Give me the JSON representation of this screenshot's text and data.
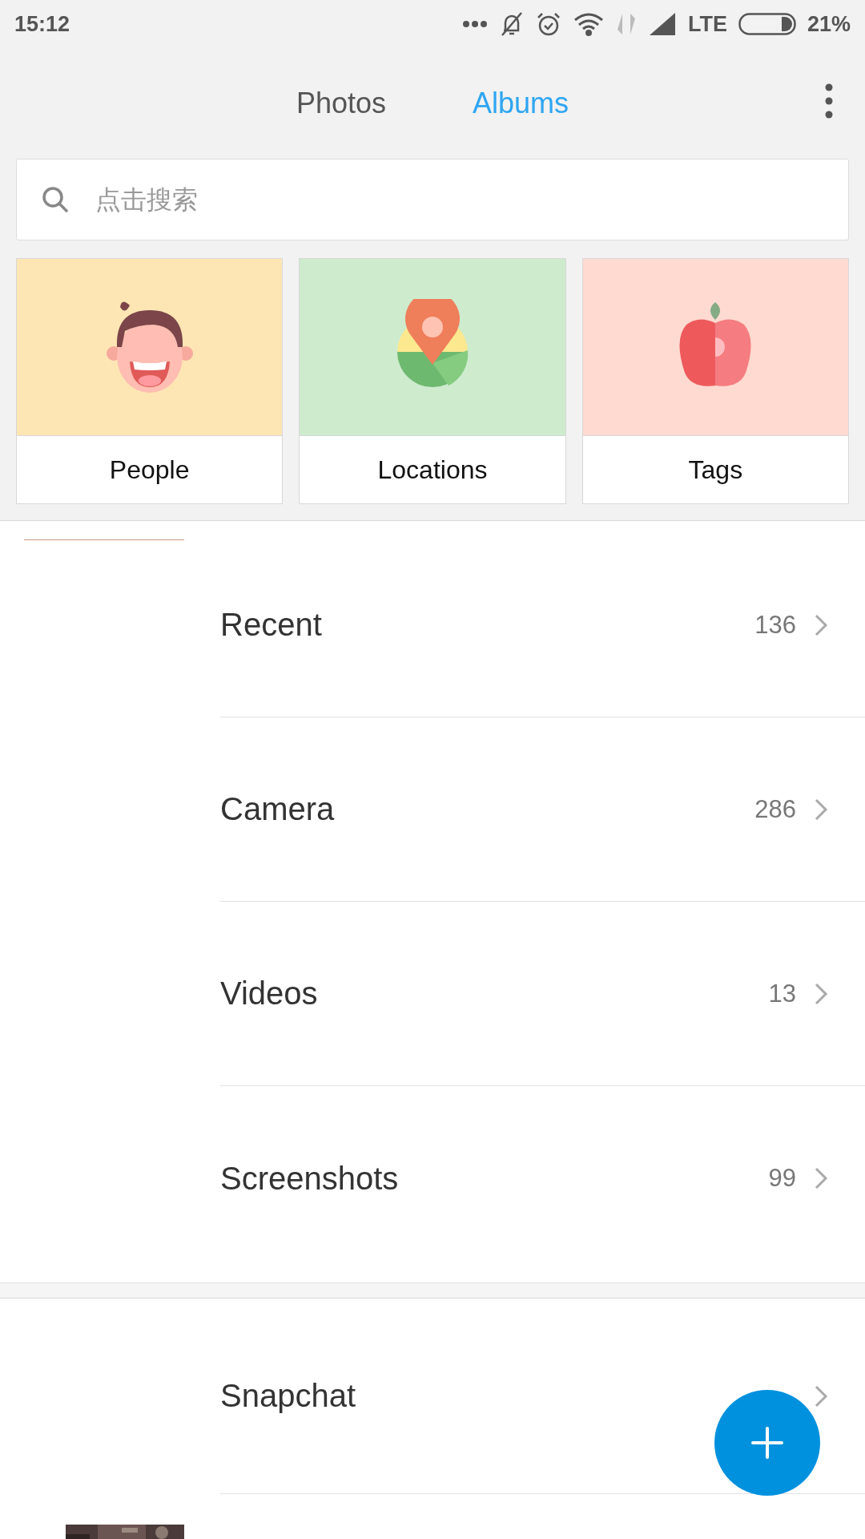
{
  "status_bar": {
    "time": "15:12",
    "network": "LTE",
    "battery": "21%"
  },
  "tabs": [
    {
      "label": "Photos",
      "selected": false
    },
    {
      "label": "Albums",
      "selected": true
    }
  ],
  "search": {
    "placeholder": "点击搜索"
  },
  "categories": [
    {
      "kind": "people",
      "label": "People",
      "color": "#fee6b4"
    },
    {
      "kind": "locations",
      "label": "Locations",
      "color": "#ceebce"
    },
    {
      "kind": "tags",
      "label": "Tags",
      "color": "#ffdad0"
    }
  ],
  "sections": [
    {
      "rows": [
        {
          "kind": "album",
          "title": "Recent",
          "count": "136"
        },
        {
          "kind": "album",
          "title": "Camera",
          "count": "286"
        },
        {
          "kind": "album",
          "title": "Videos",
          "count": "13"
        },
        {
          "kind": "album",
          "title": "Screenshots",
          "count": "99"
        }
      ]
    },
    {
      "rows": [
        {
          "kind": "album",
          "title": "Snapchat"
        },
        {
          "kind": "picture"
        }
      ]
    }
  ]
}
